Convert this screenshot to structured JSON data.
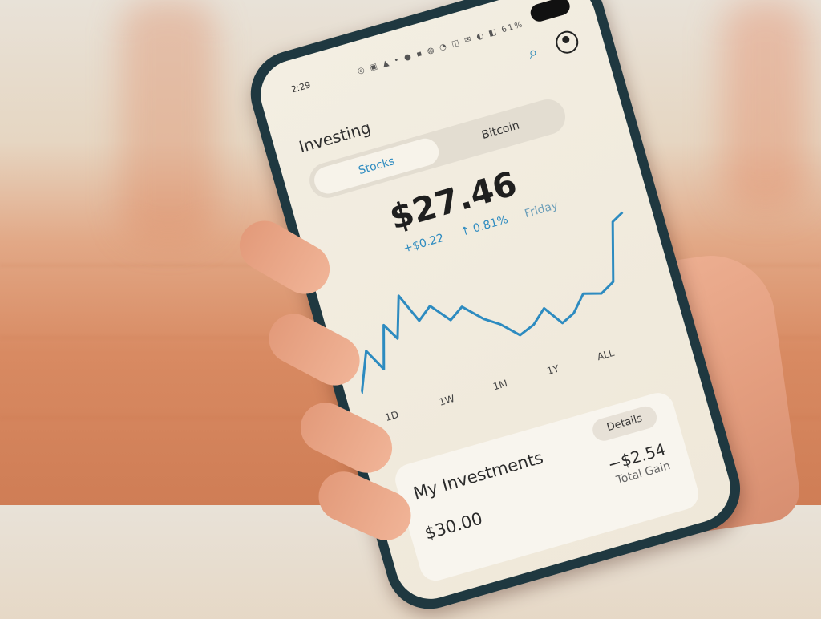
{
  "status": {
    "time": "2:29",
    "icons": "◎ ▣ ▲ • ● ▪ ◍ ◔ ◫ ✉ ◐ ◧ 61%"
  },
  "header": {
    "title": "Investing",
    "search_icon": "search-icon",
    "profile_icon": "profile-icon"
  },
  "tabs": [
    {
      "label": "Stocks"
    },
    {
      "label": "Bitcoin"
    }
  ],
  "summary": {
    "price": "$27.46",
    "change": "+$0.22",
    "percent": "↑ 0.81%",
    "period": "Friday"
  },
  "ranges": [
    {
      "label": "1D"
    },
    {
      "label": "1W"
    },
    {
      "label": "1M"
    },
    {
      "label": "1Y"
    },
    {
      "label": "ALL"
    }
  ],
  "investments": {
    "title": "My Investments",
    "details_label": "Details",
    "gain": "−$2.54",
    "gain_label": "Total Gain",
    "value": "$30.00"
  },
  "colors": {
    "accent": "#2d8bc0",
    "phone_frame": "#1f3840",
    "screen": "#f3eee2"
  }
}
